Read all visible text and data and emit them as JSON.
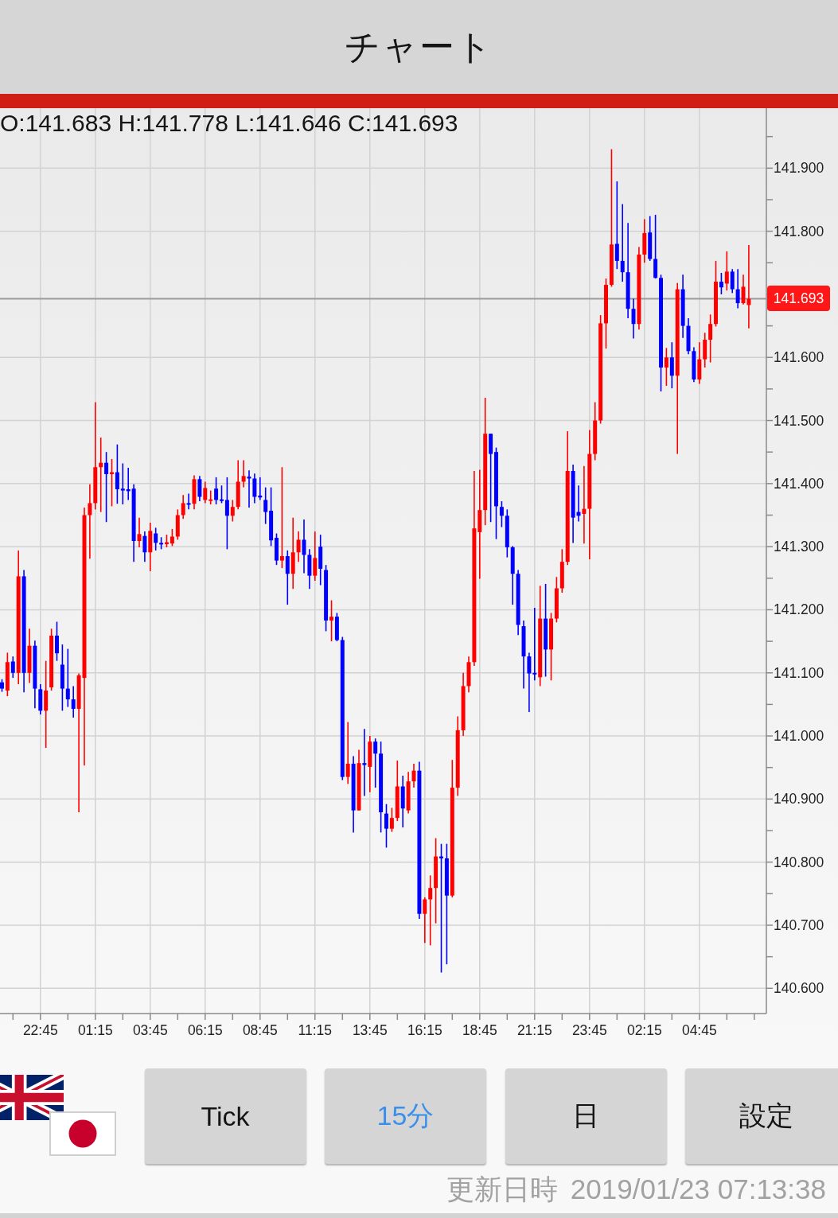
{
  "header": {
    "title": "チャート"
  },
  "chart": {
    "readout": "O:141.683 H:141.778 L:141.646 C:141.693",
    "chart_data": {
      "type": "candlestick",
      "categories": [
        null,
        null,
        null,
        null,
        null,
        null,
        null,
        "22:45",
        null,
        null,
        null,
        null,
        null,
        null,
        null,
        null,
        null,
        "01:15",
        null,
        null,
        null,
        null,
        null,
        null,
        null,
        null,
        null,
        "03:45",
        null,
        null,
        null,
        null,
        null,
        null,
        null,
        null,
        null,
        "06:15",
        null,
        null,
        null,
        null,
        null,
        null,
        null,
        null,
        null,
        "08:45",
        null,
        null,
        null,
        null,
        null,
        null,
        null,
        null,
        null,
        "11:15",
        null,
        null,
        null,
        null,
        null,
        null,
        null,
        null,
        null,
        "13:45",
        null,
        null,
        null,
        null,
        null,
        null,
        null,
        null,
        null,
        "16:15",
        null,
        null,
        null,
        null,
        null,
        null,
        null,
        null,
        null,
        "18:45",
        null,
        null,
        null,
        null,
        null,
        null,
        null,
        null,
        null,
        "21:15",
        null,
        null,
        null,
        null,
        null,
        null,
        null,
        null,
        null,
        "23:45",
        null,
        null,
        null,
        null,
        null,
        null,
        null,
        null,
        null,
        "02:15",
        null,
        null,
        null,
        null,
        null,
        null,
        null,
        null,
        null,
        "04:45",
        null,
        null,
        null,
        null,
        null,
        null,
        null,
        null,
        null
      ],
      "ohlc": [
        [
          141.085,
          141.09,
          141.07,
          141.075
        ],
        [
          141.072,
          141.132,
          141.063,
          141.117
        ],
        [
          141.118,
          141.126,
          141.092,
          141.1
        ],
        [
          141.1,
          141.294,
          141.082,
          141.253
        ],
        [
          141.253,
          141.263,
          141.069,
          141.1
        ],
        [
          141.1,
          141.17,
          141.084,
          141.143
        ],
        [
          141.143,
          141.151,
          141.044,
          141.075
        ],
        [
          141.074,
          141.082,
          141.034,
          141.04
        ],
        [
          141.04,
          141.119,
          140.981,
          141.072
        ],
        [
          141.077,
          141.17,
          141.072,
          141.159
        ],
        [
          141.159,
          141.181,
          141.119,
          141.131
        ],
        [
          141.113,
          141.145,
          141.04,
          141.075
        ],
        [
          141.075,
          141.138,
          141.046,
          141.058
        ],
        [
          141.058,
          141.079,
          141.029,
          141.043
        ],
        [
          141.043,
          141.099,
          140.879,
          141.096
        ],
        [
          141.092,
          141.362,
          140.953,
          141.35
        ],
        [
          141.35,
          141.399,
          141.281,
          141.369
        ],
        [
          141.369,
          141.529,
          141.359,
          141.426
        ],
        [
          141.426,
          141.473,
          141.355,
          141.433
        ],
        [
          141.433,
          141.45,
          141.339,
          141.415
        ],
        [
          141.415,
          141.439,
          141.364,
          141.418
        ],
        [
          141.418,
          141.462,
          141.368,
          141.391
        ],
        [
          141.392,
          141.432,
          141.367,
          141.389
        ],
        [
          141.391,
          141.425,
          141.374,
          141.388
        ],
        [
          141.392,
          141.399,
          141.276,
          141.309
        ],
        [
          141.309,
          141.346,
          141.299,
          141.32
        ],
        [
          141.317,
          141.324,
          141.276,
          141.291
        ],
        [
          141.291,
          141.338,
          141.261,
          141.325
        ],
        [
          141.321,
          141.33,
          141.294,
          141.306
        ],
        [
          141.306,
          141.315,
          141.296,
          141.304
        ],
        [
          141.304,
          141.319,
          141.299,
          141.307
        ],
        [
          141.305,
          141.328,
          141.301,
          141.316
        ],
        [
          141.316,
          141.359,
          141.311,
          141.35
        ],
        [
          141.35,
          141.382,
          141.344,
          141.369
        ],
        [
          141.369,
          141.384,
          141.359,
          141.367
        ],
        [
          141.368,
          141.413,
          141.359,
          141.407
        ],
        [
          141.407,
          141.412,
          141.372,
          141.379
        ],
        [
          141.374,
          141.403,
          141.369,
          141.393
        ],
        [
          141.373,
          141.389,
          141.367,
          141.375
        ],
        [
          141.392,
          141.41,
          141.367,
          141.374
        ],
        [
          141.375,
          141.397,
          141.369,
          141.373
        ],
        [
          141.374,
          141.41,
          141.296,
          141.349
        ],
        [
          141.349,
          141.374,
          141.34,
          141.363
        ],
        [
          141.363,
          141.437,
          141.359,
          141.403
        ],
        [
          141.403,
          141.437,
          141.394,
          141.412
        ],
        [
          141.411,
          141.421,
          141.362,
          141.408
        ],
        [
          141.408,
          141.416,
          141.369,
          141.379
        ],
        [
          141.381,
          141.41,
          141.374,
          141.378
        ],
        [
          141.374,
          141.394,
          141.336,
          141.355
        ],
        [
          141.357,
          141.394,
          141.301,
          141.31
        ],
        [
          141.314,
          141.321,
          141.271,
          141.278
        ],
        [
          141.278,
          141.426,
          141.266,
          141.285
        ],
        [
          141.285,
          141.294,
          141.208,
          141.257
        ],
        [
          141.257,
          141.346,
          141.233,
          141.291
        ],
        [
          141.291,
          141.324,
          141.276,
          141.311
        ],
        [
          141.311,
          141.343,
          141.258,
          141.287
        ],
        [
          141.287,
          141.296,
          141.233,
          141.254
        ],
        [
          141.254,
          141.324,
          141.246,
          141.282
        ],
        [
          141.3,
          141.319,
          141.239,
          141.265
        ],
        [
          141.263,
          141.271,
          141.166,
          141.183
        ],
        [
          141.183,
          141.215,
          141.15,
          141.189
        ],
        [
          141.189,
          141.195,
          141.15,
          141.152
        ],
        [
          141.152,
          141.157,
          140.93,
          140.935
        ],
        [
          140.935,
          141.022,
          140.924,
          140.956
        ],
        [
          140.956,
          140.968,
          140.847,
          140.882
        ],
        [
          140.882,
          140.978,
          140.882,
          140.957
        ],
        [
          140.957,
          141.011,
          140.905,
          140.954
        ],
        [
          140.951,
          141.0,
          140.911,
          140.991
        ],
        [
          140.991,
          140.996,
          140.918,
          140.972
        ],
        [
          140.972,
          140.991,
          140.847,
          140.879
        ],
        [
          140.877,
          140.892,
          140.823,
          140.853
        ],
        [
          140.853,
          140.886,
          140.848,
          140.87
        ],
        [
          140.87,
          140.961,
          140.865,
          140.92
        ],
        [
          140.92,
          140.937,
          140.855,
          140.885
        ],
        [
          140.882,
          140.943,
          140.877,
          140.928
        ],
        [
          140.928,
          140.956,
          140.918,
          140.945
        ],
        [
          140.945,
          140.959,
          140.71,
          140.718
        ],
        [
          140.718,
          140.744,
          140.672,
          140.741
        ],
        [
          140.741,
          140.779,
          140.668,
          140.759
        ],
        [
          140.759,
          140.838,
          140.703,
          140.809
        ],
        [
          140.809,
          140.829,
          140.625,
          140.806
        ],
        [
          140.806,
          140.829,
          140.638,
          140.747
        ],
        [
          140.747,
          140.962,
          140.744,
          140.918
        ],
        [
          140.918,
          141.031,
          140.905,
          141.009
        ],
        [
          141.009,
          141.1,
          141.0,
          141.079
        ],
        [
          141.079,
          141.126,
          141.069,
          141.117
        ],
        [
          141.117,
          141.42,
          141.111,
          141.329
        ],
        [
          141.323,
          141.422,
          141.249,
          141.358
        ],
        [
          141.358,
          141.536,
          141.334,
          141.479
        ],
        [
          141.479,
          141.479,
          141.339,
          141.447
        ],
        [
          141.45,
          141.457,
          141.312,
          141.364
        ],
        [
          141.363,
          141.372,
          141.331,
          141.349
        ],
        [
          141.349,
          141.359,
          141.283,
          141.299
        ],
        [
          141.299,
          141.301,
          141.208,
          141.257
        ],
        [
          141.257,
          141.263,
          141.16,
          141.176
        ],
        [
          141.174,
          141.183,
          141.075,
          141.126
        ],
        [
          141.126,
          141.132,
          141.038,
          141.099
        ],
        [
          141.1,
          141.203,
          141.088,
          141.098
        ],
        [
          141.093,
          141.238,
          141.079,
          141.186
        ],
        [
          141.186,
          141.241,
          141.094,
          141.137
        ],
        [
          141.137,
          141.195,
          141.088,
          141.186
        ],
        [
          141.186,
          141.252,
          141.18,
          141.234
        ],
        [
          141.234,
          141.296,
          141.227,
          141.276
        ],
        [
          141.276,
          141.483,
          141.271,
          141.42
        ],
        [
          141.42,
          141.43,
          141.306,
          141.346
        ],
        [
          141.355,
          141.397,
          141.34,
          141.349
        ],
        [
          141.352,
          141.428,
          141.305,
          141.36
        ],
        [
          141.36,
          141.485,
          141.28,
          141.447
        ],
        [
          141.447,
          141.529,
          141.437,
          141.5
        ],
        [
          141.5,
          141.667,
          141.495,
          141.654
        ],
        [
          141.654,
          141.725,
          141.614,
          141.715
        ],
        [
          141.715,
          141.93,
          141.712,
          141.779
        ],
        [
          141.78,
          141.879,
          141.74,
          141.753
        ],
        [
          141.753,
          141.843,
          141.72,
          141.735
        ],
        [
          141.735,
          141.813,
          141.662,
          141.677
        ],
        [
          141.677,
          141.693,
          141.63,
          141.653
        ],
        [
          141.653,
          141.775,
          141.644,
          141.763
        ],
        [
          141.763,
          141.819,
          141.75,
          141.797
        ],
        [
          141.798,
          141.824,
          141.753,
          141.756
        ],
        [
          141.756,
          141.826,
          141.725,
          141.726
        ],
        [
          141.726,
          141.731,
          141.546,
          141.584
        ],
        [
          141.584,
          141.615,
          141.555,
          141.6
        ],
        [
          141.6,
          141.624,
          141.551,
          141.571
        ],
        [
          141.571,
          141.718,
          141.447,
          141.708
        ],
        [
          141.708,
          141.731,
          141.631,
          141.65
        ],
        [
          141.65,
          141.662,
          141.605,
          141.61
        ],
        [
          141.61,
          141.616,
          141.561,
          141.565
        ],
        [
          141.565,
          141.624,
          141.558,
          141.597
        ],
        [
          141.597,
          141.639,
          141.584,
          141.628
        ],
        [
          141.628,
          141.668,
          141.592,
          141.653
        ],
        [
          141.653,
          141.753,
          141.649,
          141.72
        ],
        [
          141.72,
          141.734,
          141.7,
          141.711
        ],
        [
          141.717,
          141.768,
          141.706,
          141.736
        ],
        [
          141.736,
          141.74,
          141.702,
          141.708
        ],
        [
          141.708,
          141.74,
          141.678,
          141.686
        ],
        [
          141.686,
          141.731,
          141.684,
          141.712
        ],
        [
          141.683,
          141.778,
          141.646,
          141.693
        ]
      ],
      "ylim": [
        140.56,
        141.995
      ],
      "yticks": [
        {
          "value": 141.9,
          "label": "141.900"
        },
        {
          "value": 141.8,
          "label": "141.800"
        },
        {
          "value": 141.6,
          "label": "141.600"
        },
        {
          "value": 141.5,
          "label": "141.500"
        },
        {
          "value": 141.4,
          "label": "141.400"
        },
        {
          "value": 141.3,
          "label": "141.300"
        },
        {
          "value": 141.2,
          "label": "141.200"
        },
        {
          "value": 141.1,
          "label": "141.100"
        },
        {
          "value": 141.0,
          "label": "141.000"
        },
        {
          "value": 140.9,
          "label": "140.900"
        },
        {
          "value": 140.8,
          "label": "140.800"
        },
        {
          "value": 140.7,
          "label": "140.700"
        },
        {
          "value": 140.6,
          "label": "140.600"
        }
      ],
      "grid": true,
      "ref_lines": [
        {
          "axis": "y",
          "value": 141.693,
          "label": "141.693"
        }
      ]
    }
  },
  "period_buttons": [
    {
      "label": "Tick",
      "selected": false
    },
    {
      "label": "15分",
      "selected": true
    },
    {
      "label": "日",
      "selected": false
    }
  ],
  "settings_button": {
    "label": "設定"
  },
  "updated": {
    "label": "更新日時",
    "value": "2019/01/23 07:13:38"
  }
}
